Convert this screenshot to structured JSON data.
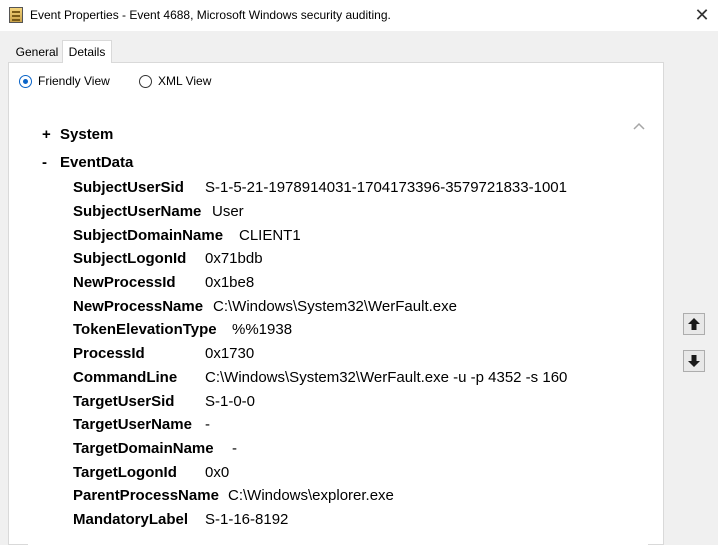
{
  "window": {
    "title": "Event Properties - Event 4688, Microsoft Windows security auditing.",
    "close_label": "✕"
  },
  "tabs": [
    {
      "label": "General",
      "active": false
    },
    {
      "label": "Details",
      "active": true
    }
  ],
  "view_options": [
    {
      "label": "Friendly View",
      "checked": true
    },
    {
      "label": "XML View",
      "checked": false
    }
  ],
  "tree": {
    "system": {
      "toggle": "+",
      "label": "System"
    },
    "eventdata": {
      "toggle": "-",
      "label": "EventData"
    }
  },
  "fields": [
    {
      "key": "SubjectUserSid",
      "value": "S-1-5-21-1978914031-1704173396-3579721833-1001"
    },
    {
      "key": "SubjectUserName",
      "value": "User"
    },
    {
      "key": "SubjectDomainName",
      "value": "CLIENT1"
    },
    {
      "key": "SubjectLogonId",
      "value": "0x71bdb"
    },
    {
      "key": "NewProcessId",
      "value": "0x1be8"
    },
    {
      "key": "NewProcessName",
      "value": "C:\\Windows\\System32\\WerFault.exe"
    },
    {
      "key": "TokenElevationType",
      "value": "%%1938"
    },
    {
      "key": "ProcessId",
      "value": "0x1730"
    },
    {
      "key": "CommandLine",
      "value": "C:\\Windows\\System32\\WerFault.exe -u -p 4352 -s 160"
    },
    {
      "key": "TargetUserSid",
      "value": "S-1-0-0"
    },
    {
      "key": "TargetUserName",
      "value": "-"
    },
    {
      "key": "TargetDomainName",
      "value": "-"
    },
    {
      "key": "TargetLogonId",
      "value": "0x0"
    },
    {
      "key": "ParentProcessName",
      "value": "C:\\Windows\\explorer.exe"
    },
    {
      "key": "MandatoryLabel",
      "value": "S-1-16-8192"
    }
  ],
  "colors": {
    "accent": "#0a64c8",
    "dialog_bg": "#f0f0f0",
    "pane_bg": "#ffffff"
  },
  "icons": {
    "app": "event-properties-icon",
    "close": "close-icon",
    "scroll_up": "chevron-up-icon",
    "previous": "arrow-up-icon",
    "next": "arrow-down-icon"
  }
}
